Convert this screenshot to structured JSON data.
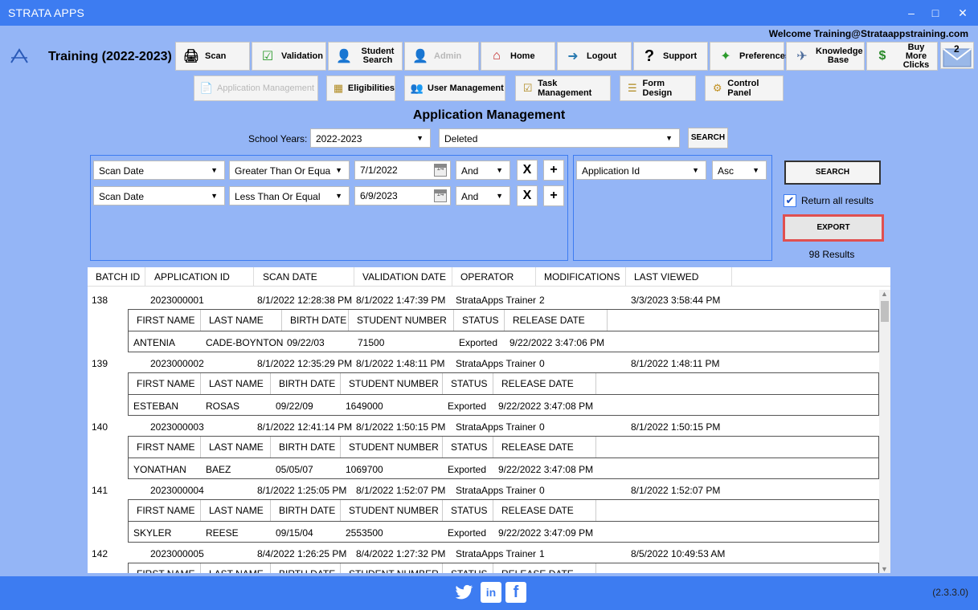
{
  "window": {
    "title": "STRATA APPS",
    "minimize": "–",
    "maximize": "□",
    "close": "✕"
  },
  "header": {
    "welcome": "Welcome Training@Strataappstraining.com",
    "org_title": "Training (2022-2023)",
    "mail_count": "2"
  },
  "nav": [
    {
      "label": "Scan",
      "icon": "printer-icon"
    },
    {
      "label": "Validation",
      "icon": "checklist-icon"
    },
    {
      "label": "Student Search",
      "icon": "student-icon"
    },
    {
      "label": "Admin",
      "icon": "admin-icon"
    },
    {
      "label": "Home",
      "icon": "home-icon"
    },
    {
      "label": "Logout",
      "icon": "logout-icon"
    },
    {
      "label": "Support",
      "icon": "question-icon"
    },
    {
      "label": "Preferences",
      "icon": "preferences-icon"
    },
    {
      "label": "Knowledge Base",
      "icon": "plane-icon"
    },
    {
      "label": "Buy More Clicks",
      "icon": "money-icon"
    }
  ],
  "subnav": [
    {
      "label": "Application Management",
      "icon": "document-icon"
    },
    {
      "label": "Eligibilities",
      "icon": "eligibility-icon"
    },
    {
      "label": "User Management",
      "icon": "users-icon"
    },
    {
      "label": "Task Management",
      "icon": "clipboard-icon"
    },
    {
      "label": "Form Design",
      "icon": "form-icon"
    },
    {
      "label": "Control Panel",
      "icon": "gear-icon"
    }
  ],
  "page_title": "Application Management",
  "filters": {
    "school_years_label": "School Years:",
    "school_year": "2022-2023",
    "status": "Deleted",
    "search_small": "SEARCH",
    "criteria": [
      {
        "field": "Scan Date",
        "operator": "Greater Than Or Equa",
        "value": "7/1/2022",
        "join": "And"
      },
      {
        "field": "Scan Date",
        "operator": "Less Than Or Equal",
        "value": "6/9/2023",
        "join": "And"
      }
    ],
    "remove_label": "X",
    "add_label": "+",
    "cal_label": "14",
    "sort_field": "Application Id",
    "sort_dir": "Asc"
  },
  "actions": {
    "search": "SEARCH",
    "return_all_label": "Return all results",
    "return_all_checked": true,
    "check_mark": "✔",
    "export": "EXPORT",
    "results": "98 Results"
  },
  "grid": {
    "headers": [
      "BATCH ID",
      "APPLICATION ID",
      "SCAN DATE",
      "VALIDATION DATE",
      "OPERATOR",
      "MODIFICATIONS",
      "LAST VIEWED"
    ],
    "sub_headers": [
      "FIRST NAME",
      "LAST NAME",
      "BIRTH DATE",
      "STUDENT NUMBER",
      "STATUS",
      "RELEASE DATE"
    ],
    "rows": [
      {
        "batch": "138",
        "app_id": "2023000001",
        "scan": "8/1/2022 12:28:38 PM",
        "validation": "8/1/2022 1:47:39 PM",
        "operator": "StrataApps Trainer",
        "mods": "2",
        "last_viewed": "3/3/2023 3:58:44 PM",
        "student": {
          "first": "ANTENIA",
          "last": "CADE-BOYNTON",
          "birth": "09/22/03",
          "number": "71500",
          "status": "Exported",
          "release": "9/22/2022 3:47:06 PM"
        }
      },
      {
        "batch": "139",
        "app_id": "2023000002",
        "scan": "8/1/2022 12:35:29 PM",
        "validation": "8/1/2022 1:48:11 PM",
        "operator": "StrataApps Trainer",
        "mods": "0",
        "last_viewed": "8/1/2022 1:48:11 PM",
        "student": {
          "first": "ESTEBAN",
          "last": "ROSAS",
          "birth": "09/22/09",
          "number": "1649000",
          "status": "Exported",
          "release": "9/22/2022 3:47:08 PM"
        }
      },
      {
        "batch": "140",
        "app_id": "2023000003",
        "scan": "8/1/2022 12:41:14 PM",
        "validation": "8/1/2022 1:50:15 PM",
        "operator": "StrataApps Trainer",
        "mods": "0",
        "last_viewed": "8/1/2022 1:50:15 PM",
        "student": {
          "first": "YONATHAN",
          "last": "BAEZ",
          "birth": "05/05/07",
          "number": "1069700",
          "status": "Exported",
          "release": "9/22/2022 3:47:08 PM"
        }
      },
      {
        "batch": "141",
        "app_id": "2023000004",
        "scan": "8/1/2022 1:25:05 PM",
        "validation": "8/1/2022 1:52:07 PM",
        "operator": "StrataApps Trainer",
        "mods": "0",
        "last_viewed": "8/1/2022 1:52:07 PM",
        "student": {
          "first": "SKYLER",
          "last": "REESE",
          "birth": "09/15/04",
          "number": "2553500",
          "status": "Exported",
          "release": "9/22/2022 3:47:09 PM"
        }
      },
      {
        "batch": "142",
        "app_id": "2023000005",
        "scan": "8/4/2022 1:26:25 PM",
        "validation": "8/4/2022 1:27:32 PM",
        "operator": "StrataApps Trainer",
        "mods": "1",
        "last_viewed": "8/5/2022 10:49:53 AM"
      }
    ]
  },
  "footer": {
    "version": "(2.3.3.0)",
    "twitter": "t",
    "linkedin": "in",
    "facebook": "f"
  }
}
